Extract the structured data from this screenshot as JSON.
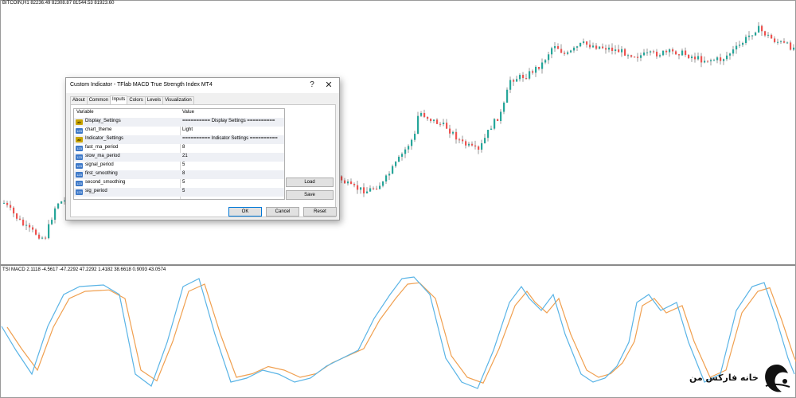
{
  "price_chart": {
    "label": "BITCOIN,H1  82236.49 82308.87 81544.53 81923.60",
    "colors": {
      "up": "#26a69a",
      "down": "#ef5350",
      "wick": "#555555"
    },
    "candles_approx_closes": [
      69000,
      68500,
      67800,
      68200,
      67100,
      66500,
      67300,
      66800,
      66200,
      67600,
      68400,
      69200,
      70100,
      70800,
      71300,
      71900,
      72500,
      73200,
      74000,
      74600,
      75200,
      75800,
      76300,
      76900,
      77400,
      78000,
      78600,
      79100,
      79500,
      80000,
      80600,
      81200,
      81800,
      82400,
      81900,
      81300,
      82100,
      82800,
      83200,
      83600,
      84300,
      84900,
      85200,
      84700,
      84100,
      83500,
      83000,
      82300,
      82900,
      83400
    ]
  },
  "tsi_chart": {
    "label": "TSI MACD 2.1118 -4.5617 -47.2292 47.2292 1.4182 38.6618 0.9093 43.0574",
    "colors": {
      "fast": "#5ab4e6",
      "slow": "#f0a050"
    }
  },
  "dialog": {
    "title": "Custom Indicator - TFlab MACD True Strength Index MT4",
    "help_glyph": "?",
    "close_glyph": "✕",
    "tabs": [
      {
        "label": "About",
        "active": false
      },
      {
        "label": "Common",
        "active": false
      },
      {
        "label": "Inputs",
        "active": true
      },
      {
        "label": "Colors",
        "active": false
      },
      {
        "label": "Levels",
        "active": false
      },
      {
        "label": "Visualization",
        "active": false
      }
    ],
    "table": {
      "header_variable": "Variable",
      "header_value": "Value",
      "rows": [
        {
          "icon": "ab",
          "icon_text": "ab",
          "variable": "Display_Settings",
          "value": "========== Display Settings =========="
        },
        {
          "icon": "num",
          "icon_text": "123",
          "variable": "chart_theme",
          "value": "Light"
        },
        {
          "icon": "ab",
          "icon_text": "ab",
          "variable": "Indicator_Settings",
          "value": "========== Indicator Settings =========="
        },
        {
          "icon": "num",
          "icon_text": "123",
          "variable": "fast_ma_period",
          "value": "8"
        },
        {
          "icon": "num",
          "icon_text": "123",
          "variable": "slow_ma_period",
          "value": "21"
        },
        {
          "icon": "num",
          "icon_text": "123",
          "variable": "signal_period",
          "value": "5"
        },
        {
          "icon": "num",
          "icon_text": "123",
          "variable": "first_smoothing",
          "value": "8"
        },
        {
          "icon": "num",
          "icon_text": "123",
          "variable": "second_smoothing",
          "value": "5"
        },
        {
          "icon": "num",
          "icon_text": "123",
          "variable": "sig_period",
          "value": "5"
        }
      ]
    },
    "buttons": {
      "load": "Load",
      "save": "Save",
      "ok": "OK",
      "cancel": "Cancel",
      "reset": "Reset"
    }
  },
  "logo": {
    "text": "خانه فارکس من"
  }
}
